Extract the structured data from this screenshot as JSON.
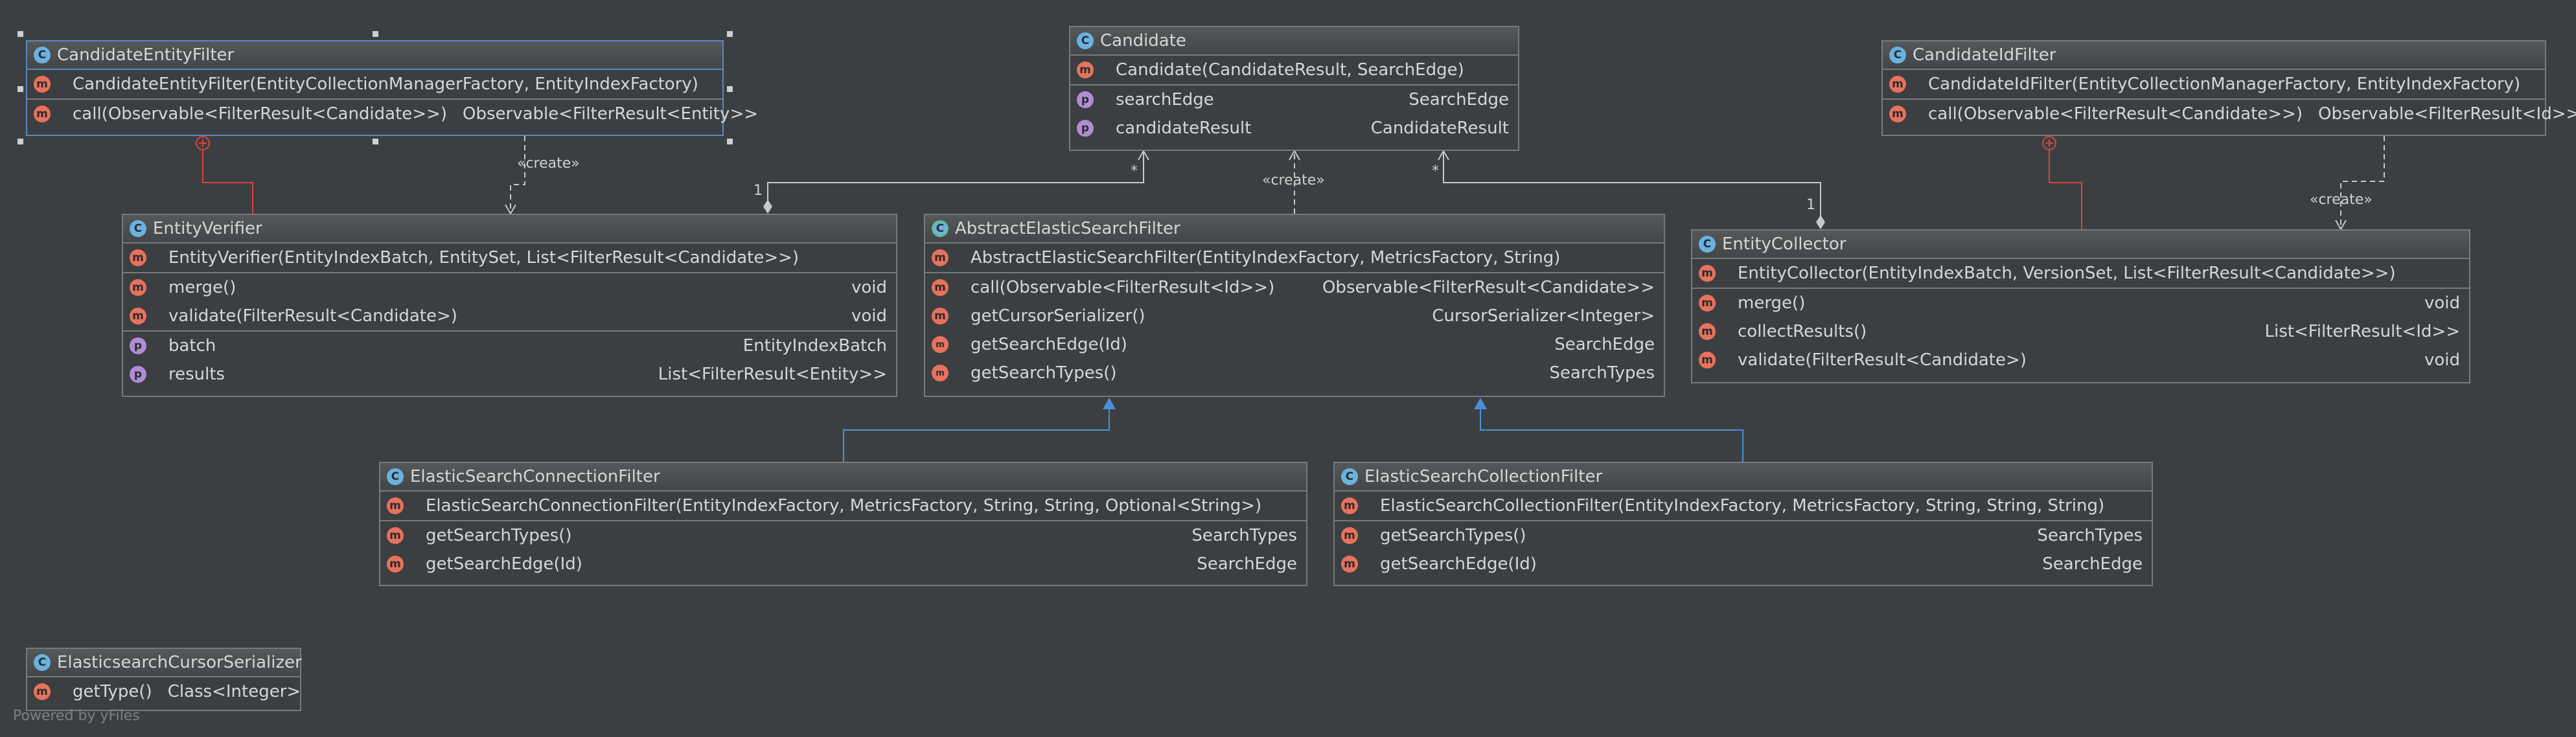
{
  "classes": {
    "candidate_entity_filter": {
      "name": "CandidateEntityFilter",
      "constructor": "CandidateEntityFilter(EntityCollectionManagerFactory, EntityIndexFactory)",
      "methods": [
        {
          "name": "call(Observable<FilterResult<Candidate>>)",
          "type": "Observable<FilterResult<Entity>>"
        }
      ]
    },
    "candidate": {
      "name": "Candidate",
      "constructor": "Candidate(CandidateResult, SearchEdge)",
      "properties": [
        {
          "name": "searchEdge",
          "type": "SearchEdge"
        },
        {
          "name": "candidateResult",
          "type": "CandidateResult"
        }
      ]
    },
    "candidate_id_filter": {
      "name": "CandidateIdFilter",
      "constructor": "CandidateIdFilter(EntityCollectionManagerFactory, EntityIndexFactory)",
      "methods": [
        {
          "name": "call(Observable<FilterResult<Candidate>>)",
          "type": "Observable<FilterResult<Id>>"
        }
      ]
    },
    "entity_verifier": {
      "name": "EntityVerifier",
      "constructor": "EntityVerifier(EntityIndexBatch, EntitySet, List<FilterResult<Candidate>>)",
      "methods": [
        {
          "name": "merge()",
          "type": "void"
        },
        {
          "name": "validate(FilterResult<Candidate>)",
          "type": "void"
        }
      ],
      "properties": [
        {
          "name": "batch",
          "type": "EntityIndexBatch"
        },
        {
          "name": "results",
          "type": "List<FilterResult<Entity>>"
        }
      ]
    },
    "abstract_es_filter": {
      "name": "AbstractElasticSearchFilter",
      "constructor": "AbstractElasticSearchFilter(EntityIndexFactory, MetricsFactory, String)",
      "methods": [
        {
          "name": "call(Observable<FilterResult<Id>>)",
          "type": "Observable<FilterResult<Candidate>>",
          "icon": "m"
        },
        {
          "name": "getCursorSerializer()",
          "type": "CursorSerializer<Integer>",
          "icon": "m"
        },
        {
          "name": "getSearchEdge(Id)",
          "type": "SearchEdge",
          "icon": "am"
        },
        {
          "name": "getSearchTypes()",
          "type": "SearchTypes",
          "icon": "am"
        }
      ]
    },
    "entity_collector": {
      "name": "EntityCollector",
      "constructor": "EntityCollector(EntityIndexBatch, VersionSet, List<FilterResult<Candidate>>)",
      "methods": [
        {
          "name": "merge()",
          "type": "void"
        },
        {
          "name": "collectResults()",
          "type": "List<FilterResult<Id>>"
        },
        {
          "name": "validate(FilterResult<Candidate>)",
          "type": "void"
        }
      ]
    },
    "es_connection_filter": {
      "name": "ElasticSearchConnectionFilter",
      "constructor": "ElasticSearchConnectionFilter(EntityIndexFactory, MetricsFactory, String, String, Optional<String>)",
      "methods": [
        {
          "name": "getSearchTypes()",
          "type": "SearchTypes"
        },
        {
          "name": "getSearchEdge(Id)",
          "type": "SearchEdge"
        }
      ]
    },
    "es_collection_filter": {
      "name": "ElasticSearchCollectionFilter",
      "constructor": "ElasticSearchCollectionFilter(EntityIndexFactory, MetricsFactory, String, String, String)",
      "methods": [
        {
          "name": "getSearchTypes()",
          "type": "SearchTypes"
        },
        {
          "name": "getSearchEdge(Id)",
          "type": "SearchEdge"
        }
      ]
    },
    "es_cursor_serializer": {
      "name": "ElasticsearchCursorSerializer",
      "methods": [
        {
          "name": "getType()",
          "type": "Class<Integer>"
        }
      ]
    }
  },
  "edge_labels": {
    "create": "«create»",
    "one": "1",
    "many": "*"
  },
  "icons": {
    "class": "C",
    "method": "m",
    "property": "p"
  },
  "colors": {
    "background": "#3c3f41",
    "border": "#777a7c",
    "selection": "#5b87c4",
    "inheritance": "#4a90d9",
    "inner_class": "#d9443f",
    "association": "#c8c8c8"
  },
  "footer": "Powered by yFiles"
}
